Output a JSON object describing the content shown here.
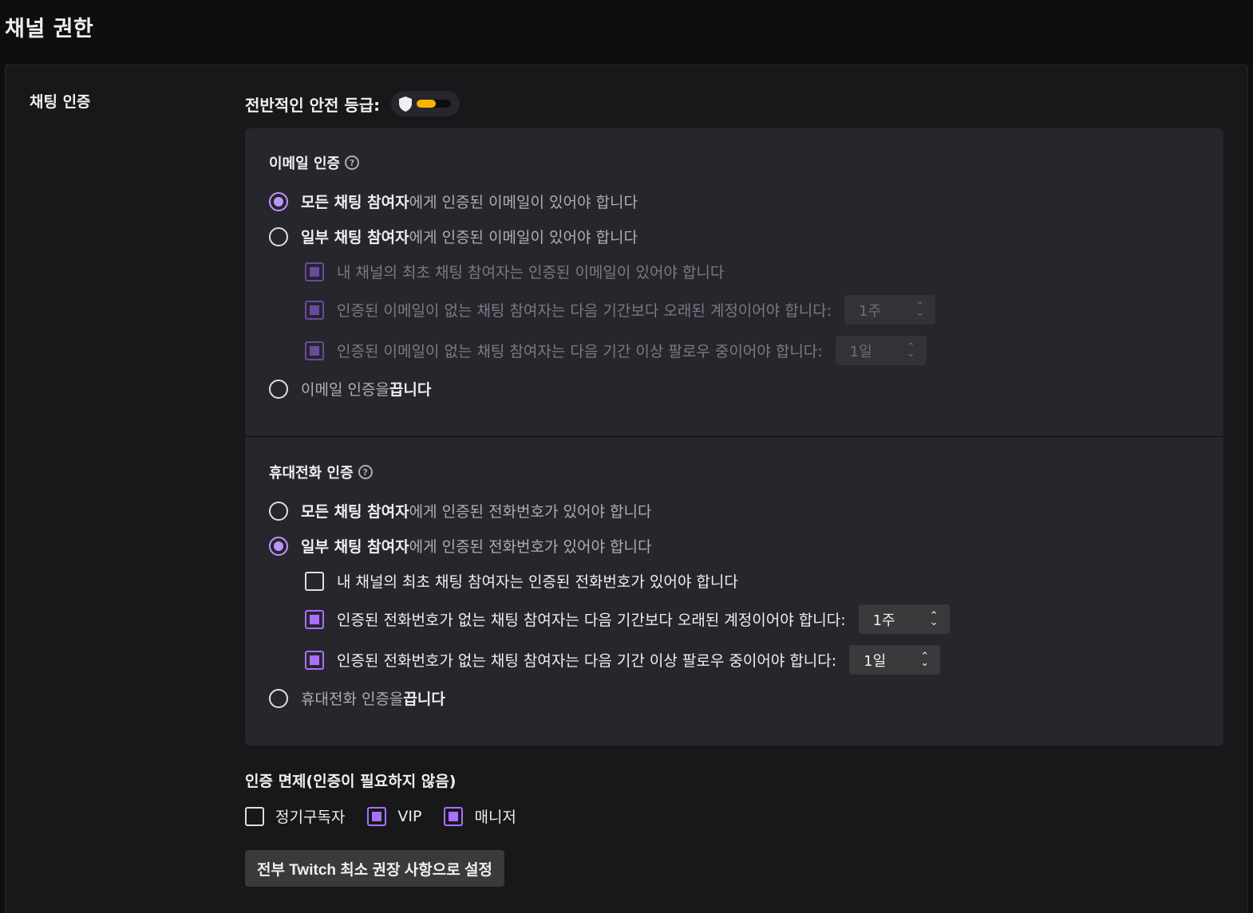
{
  "page": {
    "title": "채널 권한"
  },
  "chat_verification": {
    "section_label": "채팅 인증",
    "safety_rating": {
      "label": "전반적인 안전 등급:",
      "level": 0.55,
      "color": "#f5b400",
      "icon": "shield-icon"
    },
    "email": {
      "title": "이메일 인증",
      "options": [
        {
          "bold": "모든 채팅 참여자",
          "text": "에게 인증된 이메일이 있어야 합니다",
          "selected": true
        },
        {
          "bold": "일부 채팅 참여자",
          "text": "에게 인증된 이메일이 있어야 합니다",
          "selected": false
        }
      ],
      "sub_options": [
        {
          "text": "내 채널의 최초 채팅 참여자는 인증된 이메일이 있어야 합니다",
          "checked": true
        },
        {
          "text": "인증된 이메일이 없는 채팅 참여자는 다음 기간보다 오래된 계정이어야 합니다:",
          "checked": true,
          "select": "1주"
        },
        {
          "text": "인증된 이메일이 없는 채팅 참여자는 다음 기간 이상 팔로우 중이어야 합니다:",
          "checked": true,
          "select": "1일"
        }
      ],
      "off_option": {
        "text": "이메일 인증을 ",
        "bold": "끕니다",
        "selected": false
      }
    },
    "phone": {
      "title": "휴대전화 인증",
      "options": [
        {
          "bold": "모든 채팅 참여자",
          "text": "에게 인증된 전화번호가 있어야 합니다",
          "selected": false
        },
        {
          "bold": "일부 채팅 참여자",
          "text": "에게 인증된 전화번호가 있어야 합니다",
          "selected": true
        }
      ],
      "sub_options": [
        {
          "text": "내 채널의 최초 채팅 참여자는 인증된 전화번호가 있어야 합니다",
          "checked": false
        },
        {
          "text": "인증된 전화번호가 없는 채팅 참여자는 다음 기간보다 오래된 계정이어야 합니다:",
          "checked": true,
          "select": "1주"
        },
        {
          "text": "인증된 전화번호가 없는 채팅 참여자는 다음 기간 이상 팔로우 중이어야 합니다:",
          "checked": true,
          "select": "1일"
        }
      ],
      "off_option": {
        "text": "휴대전화 인증을 ",
        "bold": "끕니다",
        "selected": false
      }
    },
    "exemptions": {
      "title": "인증 면제(인증이 필요하지 않음)",
      "items": [
        {
          "label": "정기구독자",
          "checked": false
        },
        {
          "label": "VIP",
          "checked": true
        },
        {
          "label": "매니저",
          "checked": true
        }
      ]
    },
    "reset_button": "전부 Twitch 최소 권장 사항으로 설정"
  },
  "colors": {
    "accent": "#a970ff",
    "background": "#0e0e10",
    "card": "#18181b",
    "panel": "#26262c"
  }
}
